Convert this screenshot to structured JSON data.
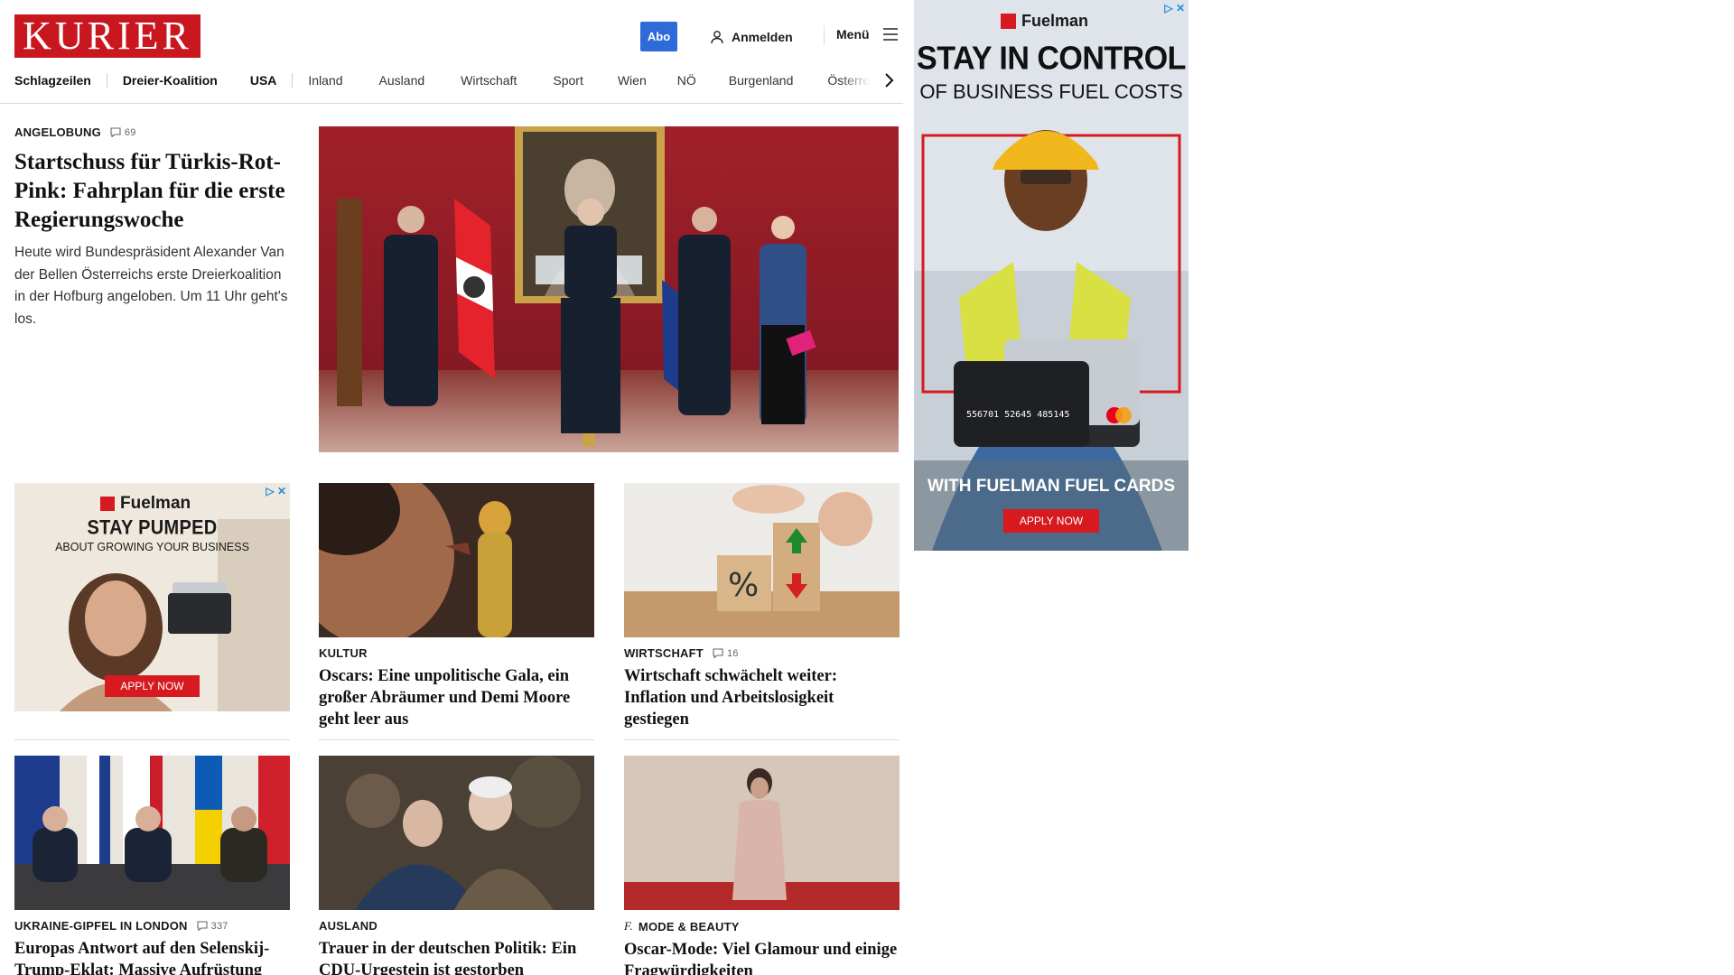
{
  "header": {
    "logo": "KURIER",
    "abo": "Abo",
    "login": "Anmelden",
    "menu": "Menü"
  },
  "nav": {
    "items": [
      "Schlagzeilen",
      "Dreier-Koalition",
      "USA",
      "Inland",
      "Ausland",
      "Wirtschaft",
      "Sport",
      "Wien",
      "NÖ",
      "Burgenland",
      "Österre"
    ]
  },
  "lead": {
    "kicker": "ANGELOBUNG",
    "comments": "69",
    "title": "Startschuss für Türkis-Rot-Pink: Fahrplan für die erste Regierungswoche",
    "teaser": "Heute wird Bundespräsident Alexander Van der Bellen Österreichs erste Dreierkoalition in der Hofburg angeloben. Um 11 Uhr geht's los."
  },
  "cards": [
    {
      "kicker": "KULTUR",
      "comments": "",
      "title": "Oscars: Eine unpolitische Gala, ein großer Abräumer und Demi Moore geht leer aus"
    },
    {
      "kicker": "WIRTSCHAFT",
      "comments": "16",
      "title": "Wirtschaft schwächelt weiter: Inflation und Arbeitslosigkeit gestiegen"
    },
    {
      "kicker": "UKRAINE-GIPFEL IN LONDON",
      "comments": "337",
      "title": "Europas Antwort auf den Selenskij-Trump-Eklat: Massive Aufrüstung"
    },
    {
      "kicker": "AUSLAND",
      "comments": "",
      "title": "Trauer in der deutschen Politik: Ein CDU-Urgestein ist gestorben"
    },
    {
      "kicker": "MODE & BEAUTY",
      "comments": "",
      "title": "Oscar-Mode: Viel Glamour und einige Fragwürdigkeiten"
    }
  ],
  "ad_small": {
    "brand": "Fuelman",
    "headline": "STAY PUMPED",
    "sub": "ABOUT GROWING YOUR BUSINESS",
    "cta": "APPLY NOW"
  },
  "ad_big": {
    "brand": "Fuelman",
    "headline": "STAY IN CONTROL",
    "sub": "OF BUSINESS FUEL COSTS",
    "tagline": "WITH FUELMAN FUEL CARDS",
    "cta": "APPLY NOW",
    "card_number": "556701 52645 485145"
  },
  "colors": {
    "brand_red": "#c8171e",
    "abo_blue": "#2e6ad8",
    "ad_red": "#d71920"
  }
}
